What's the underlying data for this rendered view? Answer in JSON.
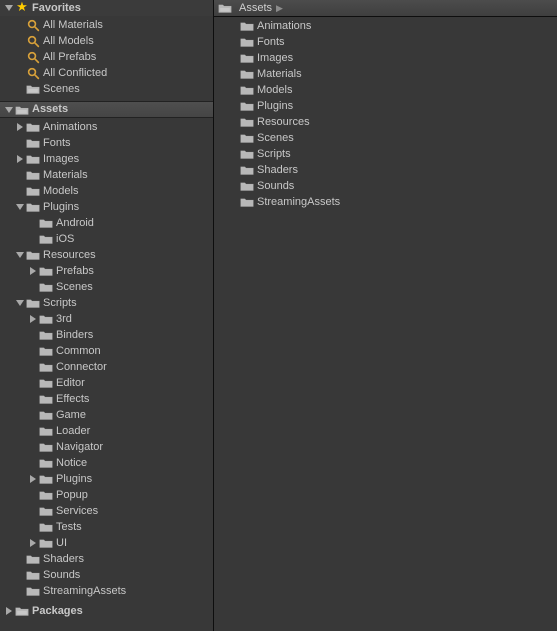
{
  "sidebar": {
    "favorites": {
      "label": "Favorites",
      "items": [
        {
          "label": "All Materials",
          "icon": "search"
        },
        {
          "label": "All Models",
          "icon": "search"
        },
        {
          "label": "All Prefabs",
          "icon": "search"
        },
        {
          "label": "All Conflicted",
          "icon": "search"
        },
        {
          "label": "Scenes",
          "icon": "pfolder"
        }
      ]
    },
    "assets": {
      "label": "Assets",
      "tree": [
        {
          "d": 1,
          "t": "closed",
          "i": "folder",
          "l": "Animations"
        },
        {
          "d": 1,
          "t": null,
          "i": "folder",
          "l": "Fonts"
        },
        {
          "d": 1,
          "t": "closed",
          "i": "folder",
          "l": "Images"
        },
        {
          "d": 1,
          "t": null,
          "i": "folder",
          "l": "Materials"
        },
        {
          "d": 1,
          "t": null,
          "i": "folder",
          "l": "Models"
        },
        {
          "d": 1,
          "t": "open",
          "i": "folder",
          "l": "Plugins"
        },
        {
          "d": 2,
          "t": null,
          "i": "folder",
          "l": "Android"
        },
        {
          "d": 2,
          "t": null,
          "i": "folder",
          "l": "iOS"
        },
        {
          "d": 1,
          "t": "open",
          "i": "folder",
          "l": "Resources"
        },
        {
          "d": 2,
          "t": "closed",
          "i": "folder",
          "l": "Prefabs"
        },
        {
          "d": 2,
          "t": null,
          "i": "folder",
          "l": "Scenes"
        },
        {
          "d": 1,
          "t": "open",
          "i": "folder",
          "l": "Scripts"
        },
        {
          "d": 2,
          "t": "closed",
          "i": "folder",
          "l": "3rd"
        },
        {
          "d": 2,
          "t": null,
          "i": "folder",
          "l": "Binders"
        },
        {
          "d": 2,
          "t": null,
          "i": "folder",
          "l": "Common"
        },
        {
          "d": 2,
          "t": null,
          "i": "folder",
          "l": "Connector"
        },
        {
          "d": 2,
          "t": null,
          "i": "folder",
          "l": "Editor"
        },
        {
          "d": 2,
          "t": null,
          "i": "folder",
          "l": "Effects"
        },
        {
          "d": 2,
          "t": null,
          "i": "folder",
          "l": "Game"
        },
        {
          "d": 2,
          "t": null,
          "i": "folder",
          "l": "Loader"
        },
        {
          "d": 2,
          "t": null,
          "i": "folder",
          "l": "Navigator"
        },
        {
          "d": 2,
          "t": null,
          "i": "folder",
          "l": "Notice"
        },
        {
          "d": 2,
          "t": "closed",
          "i": "folder",
          "l": "Plugins"
        },
        {
          "d": 2,
          "t": null,
          "i": "folder",
          "l": "Popup"
        },
        {
          "d": 2,
          "t": null,
          "i": "folder",
          "l": "Services"
        },
        {
          "d": 2,
          "t": null,
          "i": "folder",
          "l": "Tests"
        },
        {
          "d": 2,
          "t": "closed",
          "i": "folder",
          "l": "UI"
        },
        {
          "d": 1,
          "t": null,
          "i": "folder",
          "l": "Shaders"
        },
        {
          "d": 1,
          "t": null,
          "i": "folder",
          "l": "Sounds"
        },
        {
          "d": 1,
          "t": null,
          "i": "folder",
          "l": "StreamingAssets"
        }
      ]
    },
    "packages": {
      "label": "Packages"
    }
  },
  "content": {
    "breadcrumb": [
      {
        "label": "Assets"
      }
    ],
    "items": [
      {
        "i": "folder",
        "l": "Animations"
      },
      {
        "i": "folder",
        "l": "Fonts"
      },
      {
        "i": "folder",
        "l": "Images"
      },
      {
        "i": "folder",
        "l": "Materials"
      },
      {
        "i": "folder",
        "l": "Models"
      },
      {
        "i": "folder",
        "l": "Plugins"
      },
      {
        "i": "folder",
        "l": "Resources"
      },
      {
        "i": "folder",
        "l": "Scenes"
      },
      {
        "i": "folder",
        "l": "Scripts"
      },
      {
        "i": "folder",
        "l": "Shaders"
      },
      {
        "i": "folder",
        "l": "Sounds"
      },
      {
        "i": "folder",
        "l": "StreamingAssets"
      }
    ]
  }
}
